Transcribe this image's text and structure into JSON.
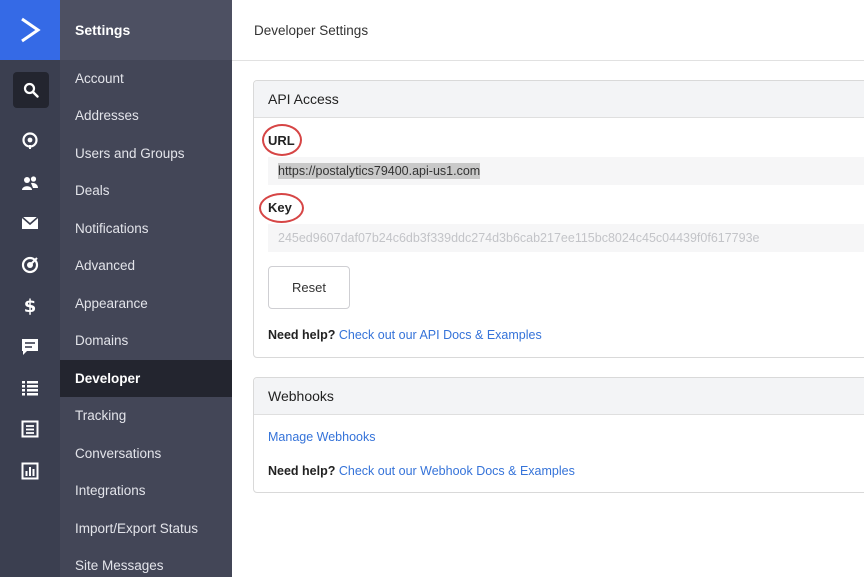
{
  "menu": {
    "title": "Settings",
    "items": [
      {
        "label": "Account"
      },
      {
        "label": "Addresses"
      },
      {
        "label": "Users and Groups"
      },
      {
        "label": "Deals"
      },
      {
        "label": "Notifications"
      },
      {
        "label": "Advanced"
      },
      {
        "label": "Appearance"
      },
      {
        "label": "Domains"
      },
      {
        "label": "Developer",
        "active": true
      },
      {
        "label": "Tracking"
      },
      {
        "label": "Conversations"
      },
      {
        "label": "Integrations"
      },
      {
        "label": "Import/Export Status"
      },
      {
        "label": "Site Messages"
      }
    ]
  },
  "rail": {
    "icons": [
      "search-icon",
      "location-pin-icon",
      "contacts-icon",
      "envelope-icon",
      "target-icon",
      "dollar-icon",
      "chat-icon",
      "list-icon",
      "document-icon",
      "bar-chart-icon"
    ]
  },
  "page": {
    "title": "Developer Settings"
  },
  "api_access": {
    "title": "API Access",
    "url_label": "URL",
    "url_value": "https://postalytics79400.api-us1.com",
    "key_label": "Key",
    "key_value": "245ed9607daf07b24c6db3f339ddc274d3b6cab217ee115bc8024c45c04439f0f617793e",
    "reset_label": "Reset",
    "help_prefix": "Need help?",
    "help_link": "Check out our API Docs & Examples"
  },
  "webhooks": {
    "title": "Webhooks",
    "manage_link": "Manage Webhooks",
    "help_prefix": "Need help?",
    "help_link": "Check out our Webhook Docs & Examples"
  },
  "colors": {
    "brand_blue": "#356ae6",
    "rail_bg": "#3b3f50",
    "menu_bg": "#434657",
    "active_bg": "#23252f",
    "link": "#3573d9",
    "annotation_red": "#d64545"
  }
}
